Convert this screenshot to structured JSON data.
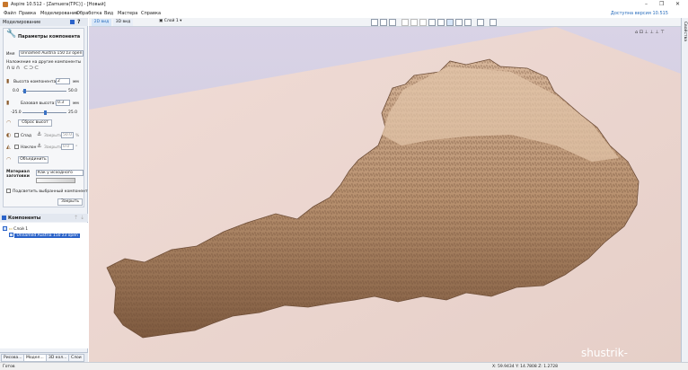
{
  "window": {
    "title": "Aspire 10.512 - [Zamuera(TPC)] - [Новый]",
    "minimize": "–",
    "maximize": "❐",
    "close": "✕"
  },
  "menu": {
    "items": [
      "Файл",
      "Правка",
      "Моделирование",
      "Обработка",
      "Вид",
      "Мастера",
      "Справка"
    ],
    "update_notice": "Доступна версия 10.515"
  },
  "left_panel": {
    "header": "Моделирование",
    "help": "?"
  },
  "component": {
    "title": "Параметры компонента",
    "name_label": "Имя",
    "name_value": "Unnamed Austria 150 z3 open",
    "combine_label": "Наложение на другие компоненты",
    "height_label": "Высота компонента:",
    "height_value": "2",
    "height_unit": "мм",
    "height_min": "0.0",
    "height_max": "50.0",
    "base_label": "Базовая высота:",
    "base_value": "0.3",
    "base_unit": "мм",
    "base_min": "-25.0",
    "base_max": "25.0",
    "reset_height": "Сброс высот",
    "fade_label": "Спад",
    "fade_close": "Закрыть",
    "fade_value": "50.0",
    "fade_unit": "%",
    "tilt_label": "Наклон",
    "tilt_close": "Закрыть",
    "tilt_value": "0.0",
    "tilt_unit": "°",
    "combine_btn": "Объединить",
    "material_label": "Материал заготовки",
    "material_value": "Как у исходного",
    "highlight_label": "Подсветить выбранный компонент",
    "close_btn": "Закрыть"
  },
  "components_tree": {
    "header": "Компоненты",
    "layer": "Слой 1",
    "item": "Unnamed Austria 150 z3 open"
  },
  "bottom_tabs": [
    "Рисова...",
    "Модел...",
    "3D кол...",
    "Слои"
  ],
  "toolbar": {
    "tab_2d": "2D вид",
    "tab_3d": "3D вид",
    "layer_select": "Слой 1"
  },
  "right_strip": {
    "label": "Свойства"
  },
  "status": {
    "left": "Готов",
    "coords": "X: 59.9434 Y: 14.7808 Z: 1.2728"
  },
  "watermark": "shustrik-maps.com",
  "colors": {
    "accent": "#2b63c9",
    "relief": "#c9a58a",
    "sheet": "#ecd8d1",
    "background": "#d5d0e2"
  }
}
